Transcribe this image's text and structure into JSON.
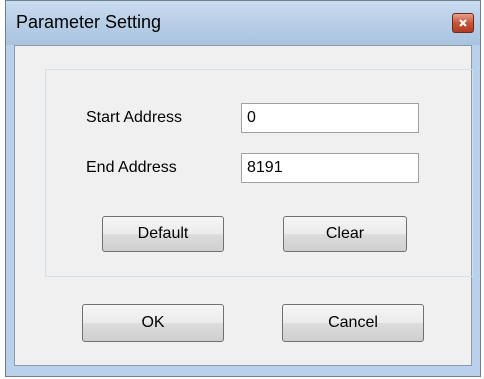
{
  "window": {
    "title": "Parameter Setting",
    "close_glyph": "x"
  },
  "form": {
    "start_address_label": "Start Address",
    "start_address_value": "0",
    "end_address_label": "End Address",
    "end_address_value": "8191"
  },
  "buttons": {
    "default_label": "Default",
    "clear_label": "Clear",
    "ok_label": "OK",
    "cancel_label": "Cancel"
  },
  "icons": {
    "close": "close-icon"
  }
}
